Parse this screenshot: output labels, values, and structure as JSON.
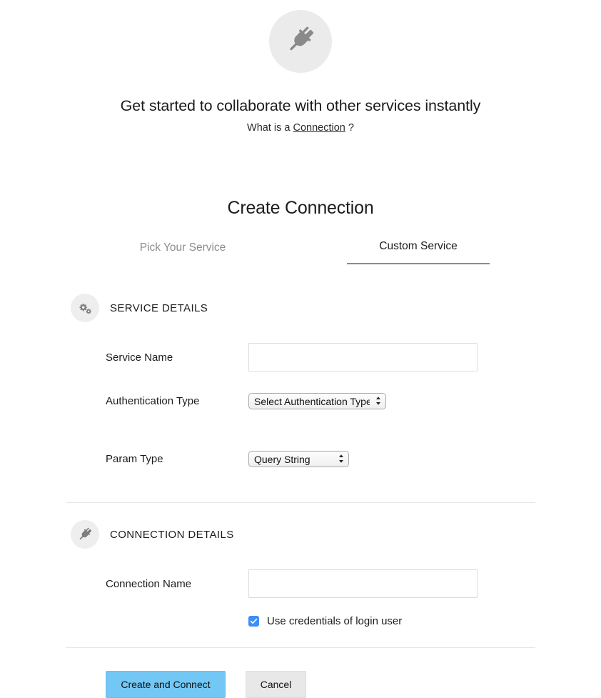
{
  "hero": {
    "icon": "plug-icon",
    "title": "Get started to collaborate with other services instantly",
    "sub_prefix": "What is a ",
    "sub_link": "Connection",
    "sub_suffix": " ?"
  },
  "card": {
    "title": "Create Connection",
    "tabs": [
      {
        "label": "Pick Your Service",
        "active": false
      },
      {
        "label": "Custom Service",
        "active": true
      }
    ]
  },
  "service_details": {
    "icon": "gears-icon",
    "heading": "SERVICE DETAILS",
    "fields": {
      "service_name": {
        "label": "Service Name",
        "value": "",
        "placeholder": ""
      },
      "authentication_type": {
        "label": "Authentication Type",
        "selected": "Select Authentication Type",
        "options": [
          "Select Authentication Type"
        ]
      },
      "param_type": {
        "label": "Param Type",
        "selected": "Query String",
        "options": [
          "Query String"
        ]
      }
    }
  },
  "connection_details": {
    "icon": "plug-icon",
    "heading": "CONNECTION DETAILS",
    "fields": {
      "connection_name": {
        "label": "Connection Name",
        "value": "",
        "placeholder": ""
      },
      "use_credentials": {
        "label": "Use credentials of login user",
        "checked": true
      }
    }
  },
  "footer": {
    "primary_label": "Create and Connect",
    "secondary_label": "Cancel"
  },
  "colors": {
    "primary_button": "#72c7f4",
    "secondary_button": "#e8e8e8",
    "checkbox_accent": "#3d8ef5",
    "icon_gray": "#8a8a8a",
    "badge_bg": "#ebebeb",
    "divider": "#e6e6e6",
    "tab_underline": "#8a8a8a",
    "inactive_tab_text": "#8c8c8c"
  }
}
